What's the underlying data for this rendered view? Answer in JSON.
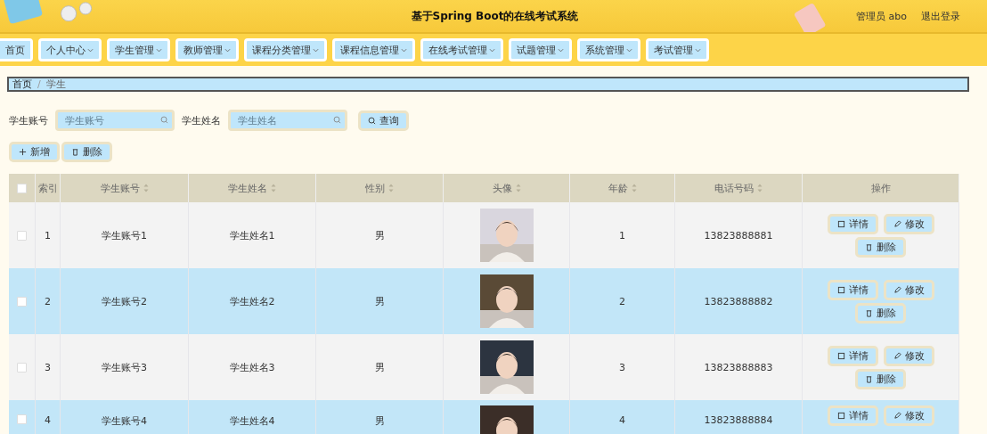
{
  "header": {
    "title": "基于Spring Boot的在线考试系统",
    "user": "管理员 abo",
    "logout": "退出登录"
  },
  "nav": [
    {
      "label": "首页",
      "dropdown": false
    },
    {
      "label": "个人中心",
      "dropdown": true
    },
    {
      "label": "学生管理",
      "dropdown": true
    },
    {
      "label": "教师管理",
      "dropdown": true
    },
    {
      "label": "课程分类管理",
      "dropdown": true
    },
    {
      "label": "课程信息管理",
      "dropdown": true
    },
    {
      "label": "在线考试管理",
      "dropdown": true
    },
    {
      "label": "试题管理",
      "dropdown": true
    },
    {
      "label": "系统管理",
      "dropdown": true
    },
    {
      "label": "考试管理",
      "dropdown": true
    }
  ],
  "breadcrumb": {
    "items": [
      "首页",
      "学生"
    ],
    "separator": "/"
  },
  "search": {
    "fields": [
      {
        "label": "学生账号",
        "placeholder": "学生账号"
      },
      {
        "label": "学生姓名",
        "placeholder": "学生姓名"
      }
    ],
    "button": "查询"
  },
  "actions": [
    "新增",
    "删除"
  ],
  "table": {
    "select_all_checked": false,
    "columns": [
      {
        "label": "索引",
        "sortable": false
      },
      {
        "label": "学生账号",
        "sortable": true
      },
      {
        "label": "学生姓名",
        "sortable": true
      },
      {
        "label": "性别",
        "sortable": true
      },
      {
        "label": "头像",
        "sortable": true
      },
      {
        "label": "年龄",
        "sortable": true
      },
      {
        "label": "电话号码",
        "sortable": true
      },
      {
        "label": "操作",
        "sortable": false
      }
    ],
    "rows": [
      {
        "checked": false,
        "index": "1",
        "account": "学生账号1",
        "name": "学生姓名1",
        "gender": "男",
        "age": "1",
        "phone": "13823888881",
        "buttons": [
          "详情",
          "修改",
          "删除"
        ]
      },
      {
        "checked": false,
        "index": "2",
        "account": "学生账号2",
        "name": "学生姓名2",
        "gender": "男",
        "age": "2",
        "phone": "13823888882",
        "buttons": [
          "详情",
          "修改",
          "删除"
        ]
      },
      {
        "checked": false,
        "index": "3",
        "account": "学生账号3",
        "name": "学生姓名3",
        "gender": "男",
        "age": "3",
        "phone": "13823888883",
        "buttons": [
          "详情",
          "修改",
          "删除"
        ]
      },
      {
        "checked": false,
        "index": "4",
        "account": "学生账号4",
        "name": "学生姓名4",
        "gender": "男",
        "age": "4",
        "phone": "13823888884",
        "buttons": [
          "详情",
          "修改"
        ]
      }
    ]
  }
}
